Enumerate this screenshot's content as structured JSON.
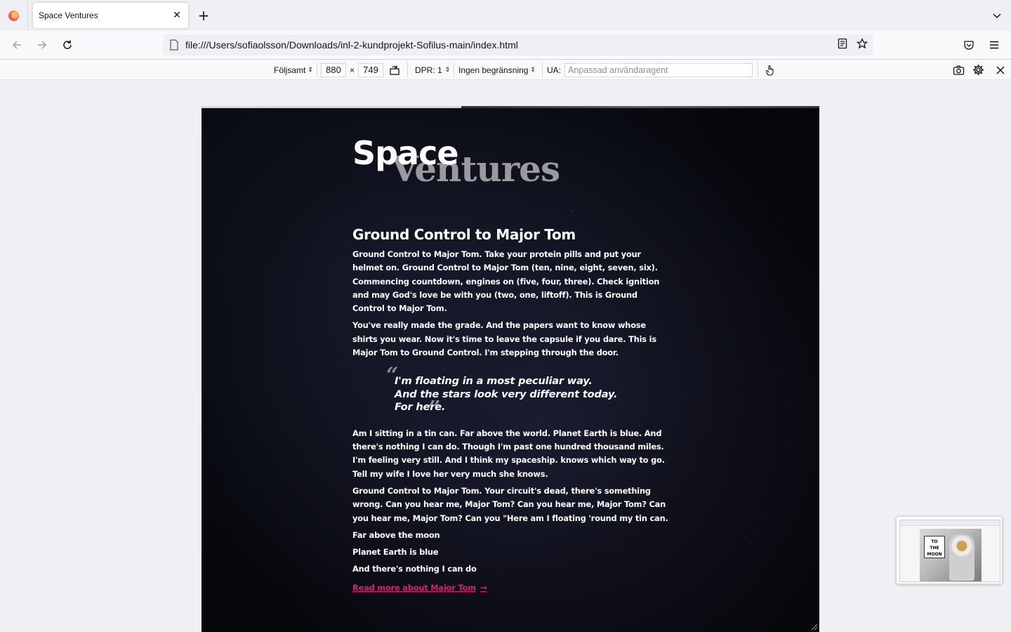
{
  "browser": {
    "tab_title": "Space Ventures",
    "url": "file:///Users/sofiaolsson/Downloads/inl-2-kundprojekt-Sofilus-main/index.html"
  },
  "rdm": {
    "device": "Följsamt",
    "width": "880",
    "times": "×",
    "height": "749",
    "dpr": "DPR: 1",
    "throttling": "Ingen begränsning",
    "ua_label": "UA:",
    "ua_placeholder": "Anpassad användaragent"
  },
  "page": {
    "logo_space": "Space",
    "logo_ventures": "Ventures",
    "heading": "Ground Control to Major Tom",
    "para1": "Ground Control to Major Tom. Take your protein pills and put your helmet on. Ground Control to Major Tom (ten, nine, eight, seven, six). Commencing countdown, engines on (five, four, three). Check ignition and may God's love be with you (two, one, liftoff). This is Ground Control to Major Tom.",
    "para2": "You've really made the grade. And the papers want to know whose shirts you wear. Now it's time to leave the capsule if you dare. This is Major Tom to Ground Control. I'm stepping through the door.",
    "quote": [
      "I'm floating in a most peculiar way.",
      "And the stars look very different today.",
      "For here."
    ],
    "para3": "Am I sitting in a tin can. Far above the world. Planet Earth is blue. And there's nothing I can do. Though I'm past one hundred thousand miles. I'm feeling very still. And I think my spaceship. knows which way to go. Tell my wife I love her very much she knows.",
    "para4": "Ground Control to Major Tom. Your circuit's dead, there's something wrong. Can you hear me, Major Tom? Can you hear me, Major Tom? Can you hear me, Major Tom? Can you \"Here am I floating 'round my tin can.",
    "lines": [
      "Far above the moon",
      "Planet Earth is blue",
      "And there's nothing I can do"
    ],
    "read_more": "Read more about Major Tom",
    "link_color": "#e4177a"
  },
  "thumbnail": {
    "sign_text": [
      "TO",
      "THE",
      "MOON"
    ]
  }
}
